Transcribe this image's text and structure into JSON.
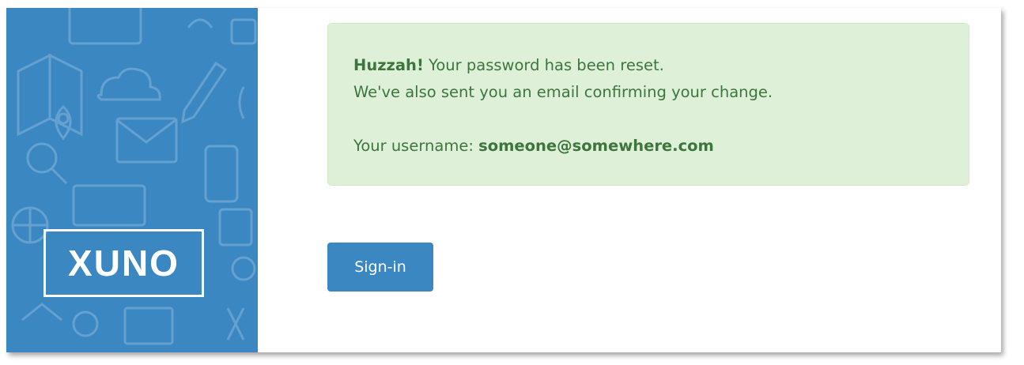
{
  "sidebar": {
    "logo_text": "XUNO",
    "background_color": "#3a87c2"
  },
  "alert": {
    "headline_bold": "Huzzah!",
    "headline_rest": " Your password has been reset.",
    "email_note": "We've also sent you an email confirming your change.",
    "username_label": "Your username: ",
    "username_value": "someone@somewhere.com",
    "background_color": "#dff0d8",
    "text_color": "#3c763d"
  },
  "actions": {
    "signin_label": "Sign-in"
  }
}
